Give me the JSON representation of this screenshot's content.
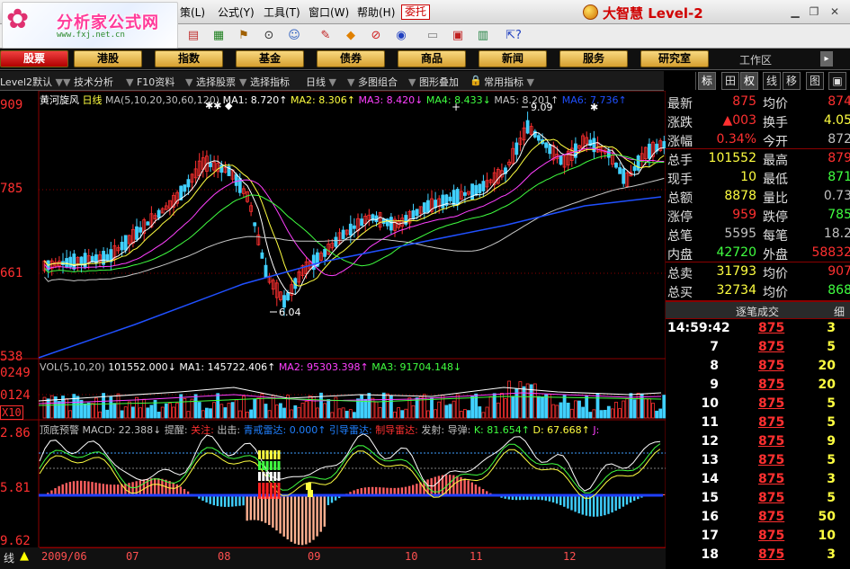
{
  "logo": {
    "title": "分析家公式网",
    "url": "www.fxj.net.cn"
  },
  "menu": {
    "items": [
      "策(L)",
      "公式(Y)",
      "工具(T)",
      "窗口(W)",
      "帮助(H)"
    ],
    "entrust": "委托",
    "brand": "大智慧 Level-2"
  },
  "funcbar": {
    "tabs": [
      "股票",
      "港股",
      "指数",
      "基金",
      "债券",
      "商品",
      "新闻",
      "服务",
      "研究室"
    ],
    "workarea": "工作区"
  },
  "subbar": {
    "items": [
      "Level2默认",
      "技术分析",
      "F10资料",
      "选择股票",
      "选择指标",
      "日线",
      "多图组合",
      "图形叠加",
      "常用指标"
    ]
  },
  "main_chart": {
    "title": "黄河旋风",
    "period": "日线",
    "ma_params": "MA(5,10,20,30,60,120)",
    "ma1": "MA1: 8.720↑",
    "ma2": "MA2: 8.306↑",
    "ma3": "MA3: 8.420↓",
    "ma4": "MA4: 8.433↓",
    "ma5": "MA5: 8.201↑",
    "ma6": "MA6: 7.736↑",
    "y_labels": [
      "909",
      "785",
      "661",
      "538"
    ],
    "high_marker": "9.09",
    "low_marker": "6.04"
  },
  "vol_chart": {
    "title": "VOL(5,10,20)",
    "value": "101552.000↓",
    "ma1": "MA1: 145722.406↑",
    "ma2": "MA2: 95303.398↑",
    "ma3": "MA3: 91704.148↓",
    "y_labels": [
      "0249",
      "0124",
      "X10"
    ]
  },
  "ind_chart": {
    "title": "顶底预警",
    "macd": "MACD: 22.388↓",
    "tixing": "提醒:",
    "guanzhu": "关注:",
    "chuji": "出击:",
    "qingjie": "青戒雷达: 0.000↑",
    "zhanggu": "引导雷达:",
    "zhidao": "制导雷达:",
    "fashe": "发射:",
    "daodan": "导弹:",
    "k": "K: 81.654↑",
    "d": "D: 67.668↑",
    "j": "J:",
    "y_labels": [
      "2.86",
      "5.81",
      "9.62"
    ]
  },
  "x_axis": {
    "labels": [
      "2009/06",
      "07",
      "08",
      "09",
      "10",
      "11",
      "12"
    ],
    "corner": "线"
  },
  "quote_tabs": [
    "标",
    "田",
    "权",
    "线",
    "移",
    "图"
  ],
  "quote": [
    {
      "l": "最新",
      "v": "875",
      "vc": "#ff3030",
      "r": "均价",
      "rv": "874",
      "rc": "#ff3030"
    },
    {
      "l": "涨跌",
      "v": "▲003",
      "vc": "#ff3030",
      "r": "换手",
      "rv": "4.05",
      "rc": "#ffff40"
    },
    {
      "l": "涨幅",
      "v": "0.34%",
      "vc": "#ff3030",
      "r": "今开",
      "rv": "872",
      "rc": "#c0c0c0"
    },
    {
      "l": "总手",
      "v": "101552",
      "vc": "#ffff40",
      "r": "最高",
      "rv": "879",
      "rc": "#ff3030"
    },
    {
      "l": "现手",
      "v": "10",
      "vc": "#ffff40",
      "r": "最低",
      "rv": "871",
      "rc": "#40ff40"
    },
    {
      "l": "总额",
      "v": "8878",
      "vc": "#ffff40",
      "r": "量比",
      "rv": "0.73",
      "rc": "#c0c0c0"
    },
    {
      "l": "涨停",
      "v": "959",
      "vc": "#ff3030",
      "r": "跌停",
      "rv": "785",
      "rc": "#40ff40"
    },
    {
      "l": "总笔",
      "v": "5595",
      "vc": "#c0c0c0",
      "r": "每笔",
      "rv": "18.2",
      "rc": "#c0c0c0"
    },
    {
      "l": "内盘",
      "v": "42720",
      "vc": "#40ff40",
      "r": "外盘",
      "rv": "58832",
      "rc": "#ff3030"
    },
    {
      "l": "总卖",
      "v": "31793",
      "vc": "#ffff40",
      "r": "均价",
      "rv": "907",
      "rc": "#ff3030"
    },
    {
      "l": "总买",
      "v": "32734",
      "vc": "#ffff40",
      "r": "均价",
      "rv": "868",
      "rc": "#40ff40"
    }
  ],
  "trades_header": {
    "title": "逐笔成交",
    "tab": "细"
  },
  "trades": [
    {
      "t": "14:59:42",
      "p": "875",
      "q": "3",
      "qc": "#ffff40"
    },
    {
      "t": "7",
      "p": "875",
      "q": "5",
      "qc": "#ffff40"
    },
    {
      "t": "8",
      "p": "875",
      "q": "20",
      "qc": "#ffff40"
    },
    {
      "t": "9",
      "p": "875",
      "q": "20",
      "qc": "#ffff40"
    },
    {
      "t": "10",
      "p": "875",
      "q": "5",
      "qc": "#ffff40"
    },
    {
      "t": "11",
      "p": "875",
      "q": "5",
      "qc": "#ffff40"
    },
    {
      "t": "12",
      "p": "875",
      "q": "9",
      "qc": "#ffff40"
    },
    {
      "t": "13",
      "p": "875",
      "q": "5",
      "qc": "#ffff40"
    },
    {
      "t": "14",
      "p": "875",
      "q": "3",
      "qc": "#ffff40"
    },
    {
      "t": "15",
      "p": "875",
      "q": "5",
      "qc": "#ffff40"
    },
    {
      "t": "16",
      "p": "875",
      "q": "50",
      "qc": "#ffff40"
    },
    {
      "t": "17",
      "p": "875",
      "q": "10",
      "qc": "#ffff40"
    },
    {
      "t": "18",
      "p": "875",
      "q": "3",
      "qc": "#ffff40"
    }
  ],
  "colors": {
    "up": "#ff3030",
    "down": "#40d0ff",
    "ma1": "#ffffff",
    "ma2": "#ffff40",
    "ma3": "#ff40ff",
    "ma4": "#40ff40",
    "ma5": "#c8c8c8",
    "ma6": "#2050ff",
    "grid": "#8b0000"
  }
}
